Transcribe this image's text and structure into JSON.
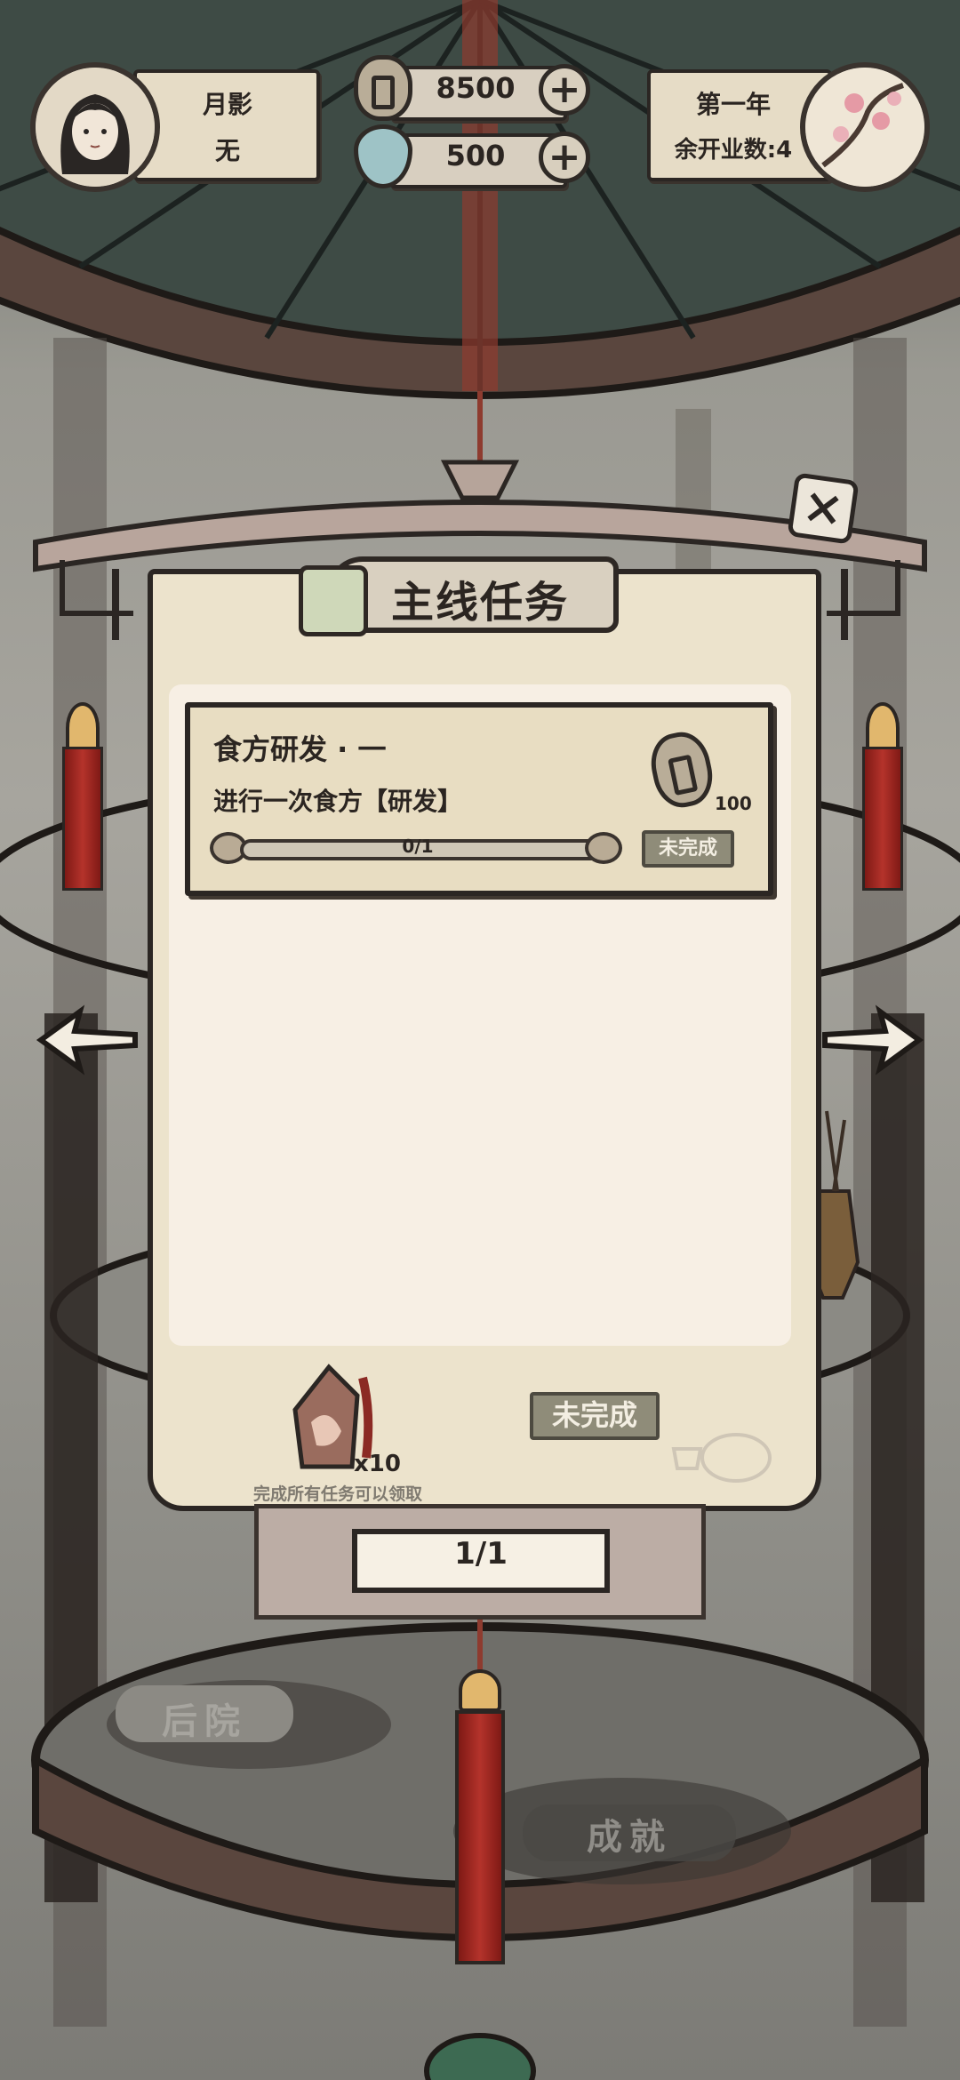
{
  "player": {
    "name": "月影",
    "title": "无",
    "avatar_icon": "player-portrait-icon"
  },
  "currency": {
    "coins": "8500",
    "gems": "500"
  },
  "year": {
    "label": "第一年",
    "days_left": "余开业数:4",
    "season_icon": "plum-blossom-icon"
  },
  "panel": {
    "title": "主线任务",
    "tasks": [
      {
        "name": "食方研发 · 一",
        "description": "进行一次食方【研发】",
        "reward_amount": "100",
        "progress": "0/1",
        "progress_fraction": 0,
        "status": "未完成"
      }
    ],
    "final_reward": {
      "count": "x10",
      "hint": "完成所有任务可以领取",
      "status": "未完成"
    },
    "page": "1/1"
  },
  "scene": {
    "backyard_label": "后院",
    "achievement_label": "成就"
  },
  "colors": {
    "ink": "#2b2623",
    "paper": "#ece3cc",
    "tassel": "#a92c24",
    "button": "#8f8c79"
  }
}
